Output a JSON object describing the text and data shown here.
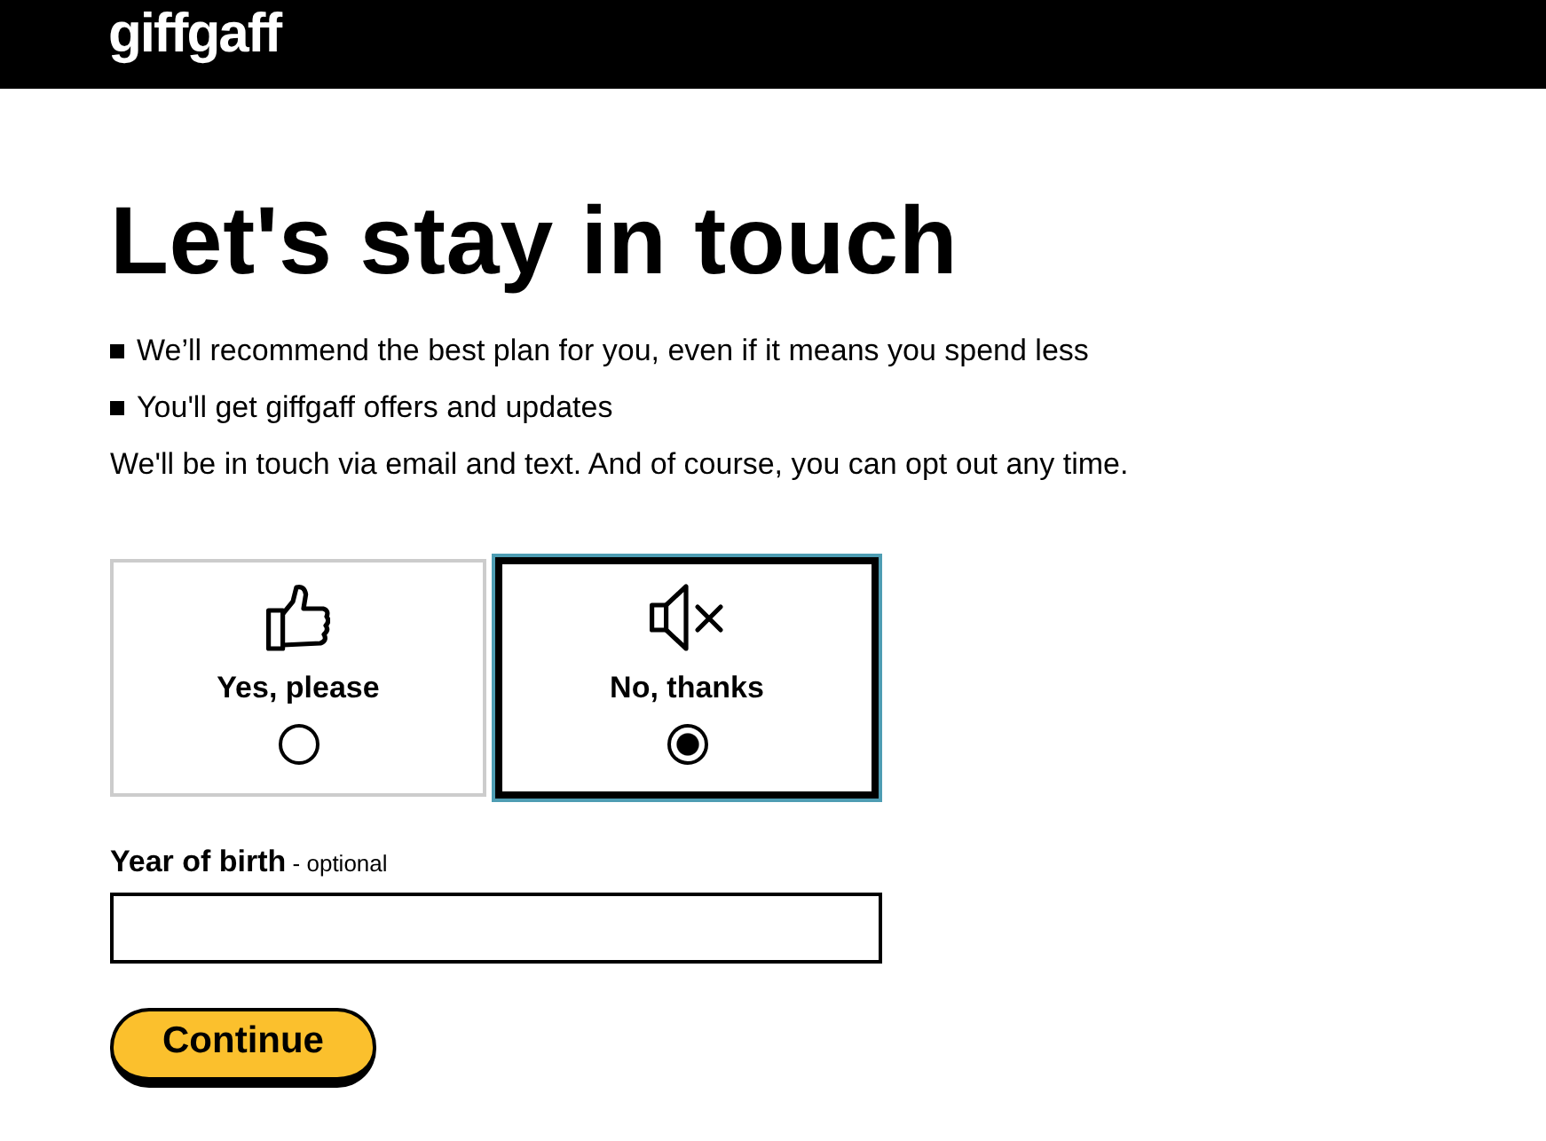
{
  "header": {
    "logo": "giffgaff"
  },
  "heading": "Let's stay in touch",
  "bullets": [
    "We’ll recommend the best plan for you, even if it means you spend less",
    "You'll get giffgaff offers and updates"
  ],
  "note": "We'll be in touch via email and text. And of course, you can opt out any time.",
  "options": [
    {
      "label": "Yes, please",
      "kind": "thumbs-up",
      "selected": false
    },
    {
      "label": "No, thanks",
      "kind": "muted",
      "selected": true
    }
  ],
  "year_field": {
    "label": "**Year of birth** - optional"
  },
  "continue_button": "Continue"
}
